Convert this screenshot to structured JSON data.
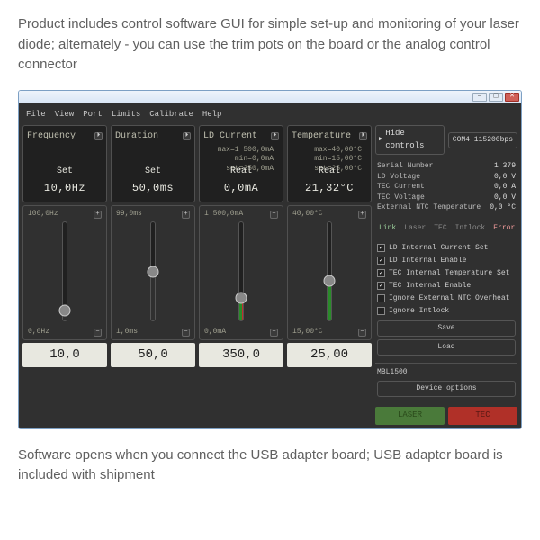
{
  "intro_text": "Product includes control software GUI for simple set-up and monitoring of your laser diode; alternately - you can use the trim pots on the board or the analog control connector",
  "outro_text": "Software opens when you connect the USB adapter board; USB adapter board is included with shipment",
  "menu": {
    "file": "File",
    "view": "View",
    "port": "Port",
    "limits": "Limits",
    "calibrate": "Calibrate",
    "help": "Help"
  },
  "hide_controls_label": "Hide controls",
  "port_combo": "COM4  115200bps",
  "channels": [
    {
      "title": "Frequency",
      "info": [],
      "big_label": "Set",
      "big_value": "10,0Hz",
      "range_max": "100,0Hz",
      "range_min": "0,0Hz",
      "fill_pct": 10,
      "fill_color": "#303030",
      "input_value": "10,0"
    },
    {
      "title": "Duration",
      "info": [],
      "big_label": "Set",
      "big_value": "50,0ms",
      "range_max": "99,0ms",
      "range_min": "1,0ms",
      "fill_pct": 50,
      "fill_color": "#303030",
      "input_value": "50,0"
    },
    {
      "title": "LD Current",
      "info": [
        "max=1 500,0mA",
        "min=0,0mA",
        "set=350,0mA"
      ],
      "big_label": "Real",
      "big_value": "0,0mA",
      "range_max": "1 500,0mA",
      "range_min": "0,0mA",
      "fill_pct": 23,
      "fill_color": "#2a8a2a",
      "edge": true,
      "input_value": "350,0"
    },
    {
      "title": "Temperature",
      "info": [
        "max=40,00°C",
        "min=15,00°C",
        "set=25,00°C"
      ],
      "big_label": "Real",
      "big_value": "21,32°C",
      "range_max": "40,00°C",
      "range_min": "15,00°C",
      "fill_pct": 40,
      "fill_color": "#2a8a2a",
      "input_value": "25,00"
    }
  ],
  "status": [
    {
      "k": "Serial Number",
      "v": "1 379",
      "u": ""
    },
    {
      "k": "LD Voltage",
      "v": "0,0",
      "u": "V"
    },
    {
      "k": "TEC Current",
      "v": "0,0",
      "u": "A"
    },
    {
      "k": "TEC Voltage",
      "v": "0,0",
      "u": "V"
    },
    {
      "k": "External NTC Temperature",
      "v": "0,0",
      "u": "°C"
    }
  ],
  "tabs": {
    "link": "Link",
    "laser": "Laser",
    "tec": "TEC",
    "intlock": "Intlock",
    "error": "Error"
  },
  "options": [
    {
      "checked": true,
      "label": "LD Internal Current Set"
    },
    {
      "checked": true,
      "label": "LD Internal Enable"
    },
    {
      "checked": true,
      "label": "TEC Internal Temperature Set"
    },
    {
      "checked": true,
      "label": "TEC Internal Enable"
    },
    {
      "checked": false,
      "label": "Ignore External NTC Overheat"
    },
    {
      "checked": false,
      "label": "Ignore Intlock"
    }
  ],
  "save_label": "Save",
  "load_label": "Load",
  "device_model": "MBL1500",
  "device_options_label": "Device options",
  "laser_button": "LASER",
  "tec_button": "TEC"
}
